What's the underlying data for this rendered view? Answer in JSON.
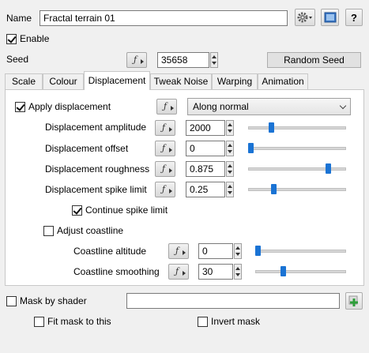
{
  "header": {
    "name_label": "Name",
    "name_value": "Fractal terrain 01",
    "icons": [
      "gear-dropdown-icon",
      "preview-icon",
      "help-icon"
    ],
    "help_glyph": "?"
  },
  "enable": {
    "label": "Enable",
    "checked": true
  },
  "seed": {
    "label": "Seed",
    "value": "35658",
    "random_button": "Random Seed",
    "fn_glyph": "ƒ"
  },
  "tabs": [
    {
      "label": "Scale"
    },
    {
      "label": "Colour"
    },
    {
      "label": "Displacement",
      "active": true
    },
    {
      "label": "Tweak Noise"
    },
    {
      "label": "Warping"
    },
    {
      "label": "Animation"
    }
  ],
  "displacement": {
    "apply": {
      "label": "Apply displacement",
      "checked": true,
      "mode": "Along normal"
    },
    "amplitude": {
      "label": "Displacement amplitude",
      "value": "2000"
    },
    "offset": {
      "label": "Displacement offset",
      "value": "0"
    },
    "roughness": {
      "label": "Displacement roughness",
      "value": "0.875"
    },
    "spike_limit": {
      "label": "Displacement spike limit",
      "value": "0.25"
    },
    "continue_spike": {
      "label": "Continue spike limit",
      "checked": true
    },
    "coastline": {
      "label": "Adjust coastline",
      "checked": false
    },
    "coast_altitude": {
      "label": "Coastline altitude",
      "value": "0"
    },
    "coast_smoothing": {
      "label": "Coastline smoothing",
      "value": "30"
    },
    "slider_levels": {
      "amplitude": 0.22,
      "offset": 0.0,
      "roughness": 0.84,
      "spike_limit": 0.25,
      "coast_altitude": 0.0,
      "coast_smoothing": 0.3
    }
  },
  "mask": {
    "mask_by_shader": {
      "label": "Mask by shader",
      "checked": false,
      "value": ""
    },
    "fit_mask": {
      "label": "Fit mask to this",
      "checked": false
    },
    "invert_mask": {
      "label": "Invert mask",
      "checked": false
    }
  },
  "colors": {
    "slider_thumb": "#1a73d4",
    "add_icon": "#2e9e3a"
  }
}
